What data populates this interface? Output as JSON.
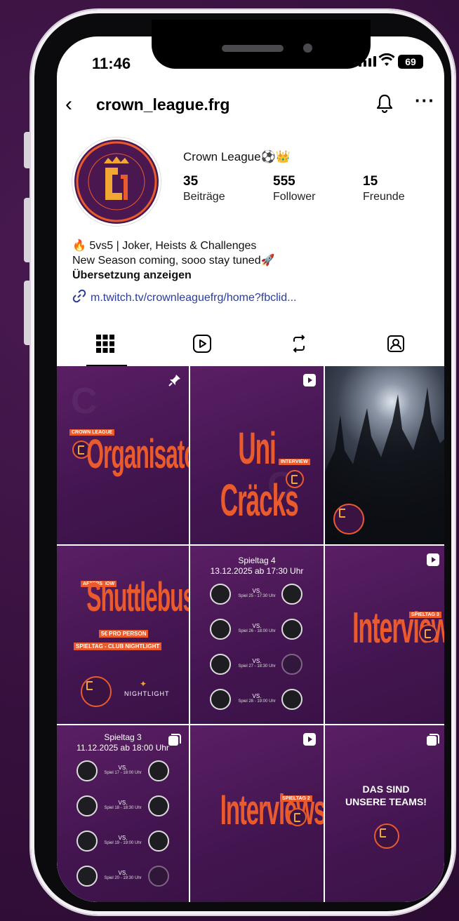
{
  "status_bar": {
    "time": "11:46",
    "battery": "69"
  },
  "header": {
    "username": "crown_league.frg",
    "more_label": "···"
  },
  "profile": {
    "display_name": "Crown League⚽👑",
    "stats": [
      {
        "value": "35",
        "label": "Beiträge"
      },
      {
        "value": "555",
        "label": "Follower"
      },
      {
        "value": "15",
        "label": "Freunde"
      }
    ],
    "bio_line1": "🔥 5vs5 | Joker, Heists & Challenges",
    "bio_line2": "New Season coming, sooo stay tuned🚀",
    "translate_label": "Übersetzung anzeigen",
    "link": "m.twitch.tv/crownleaguefrg/home?fbclid..."
  },
  "tabs": [
    "grid-icon",
    "reels-icon",
    "reposts-icon",
    "tagged-icon"
  ],
  "posts": {
    "p1": {
      "tag": "CROWN LEAGUE",
      "title": "Organisatoren"
    },
    "p2": {
      "title": "Uni Cräcks",
      "tag": "INTERVIEW"
    },
    "p4": {
      "tag": "AFTERSHOW",
      "title": "Shuttlebus",
      "line1": "5€ PRO PERSON",
      "line2": "SPIELTAG - CLUB NIGHTLIGHT",
      "partner": "NIGHTLIGHT"
    },
    "p5": {
      "title_line1": "Spieltag 4",
      "title_line2": "13.12.2025 ab 17:30 Uhr",
      "matches": [
        {
          "vs": "VS.",
          "time": "Spiel 25 - 17:30 Uhr"
        },
        {
          "vs": "VS.",
          "time": "Spiel 26 - 18:00 Uhr"
        },
        {
          "vs": "VS.",
          "time": "Spiel 27 - 18:30 Uhr"
        },
        {
          "vs": "VS.",
          "time": "Spiel 28 - 19:00 Uhr"
        }
      ]
    },
    "p6": {
      "title": "Interview",
      "tag": "SPIELTAG 3"
    },
    "p7": {
      "title_line1": "Spieltag 3",
      "title_line2": "11.12.2025 ab 18:00 Uhr",
      "matches": [
        {
          "vs": "VS.",
          "time": "Spiel 17 - 18:00 Uhr"
        },
        {
          "vs": "VS.",
          "time": "Spiel 18 - 18:30 Uhr"
        },
        {
          "vs": "VS.",
          "time": "Spiel 19 - 19:00 Uhr"
        },
        {
          "vs": "VS.",
          "time": "Spiel 20 - 19:30 Uhr"
        }
      ]
    },
    "p8": {
      "title": "Interviews",
      "tag": "SPIELTAG 2"
    },
    "p9": {
      "line1": "DAS SIND",
      "line2": "UNSERE TEAMS!"
    }
  },
  "colors": {
    "brand_purple": "#431550",
    "brand_orange": "#e95a2d",
    "link_blue": "#2a3d9a"
  }
}
